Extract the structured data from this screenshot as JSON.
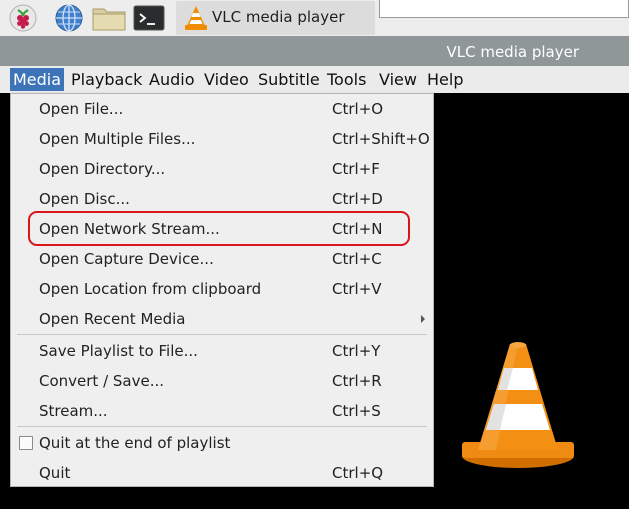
{
  "taskbar": {
    "task_label": "VLC media player"
  },
  "window": {
    "title": "VLC media player"
  },
  "menubar": {
    "items": [
      "Media",
      "Playback",
      "Audio",
      "Video",
      "Subtitle",
      "Tools",
      "View",
      "Help"
    ],
    "active": "Media"
  },
  "media_menu": {
    "items": [
      {
        "label": "Open File...",
        "shortcut": "Ctrl+O"
      },
      {
        "label": "Open Multiple Files...",
        "shortcut": "Ctrl+Shift+O"
      },
      {
        "label": "Open Directory...",
        "shortcut": "Ctrl+F"
      },
      {
        "label": "Open Disc...",
        "shortcut": "Ctrl+D"
      },
      {
        "label": "Open Network Stream...",
        "shortcut": "Ctrl+N"
      },
      {
        "label": "Open Capture Device...",
        "shortcut": "Ctrl+C"
      },
      {
        "label": "Open Location from clipboard",
        "shortcut": "Ctrl+V"
      },
      {
        "label": "Open Recent Media",
        "shortcut": ""
      },
      {
        "label": "Save Playlist to File...",
        "shortcut": "Ctrl+Y"
      },
      {
        "label": "Convert / Save...",
        "shortcut": "Ctrl+R"
      },
      {
        "label": "Stream...",
        "shortcut": "Ctrl+S"
      },
      {
        "label": "Quit at the end of playlist",
        "shortcut": ""
      },
      {
        "label": "Quit",
        "shortcut": "Ctrl+Q"
      }
    ]
  },
  "colors": {
    "menubar_active": "#3d74b8",
    "highlight_ring": "#d9161b",
    "titlebar": "#8f9799",
    "video_background": "#000000"
  }
}
